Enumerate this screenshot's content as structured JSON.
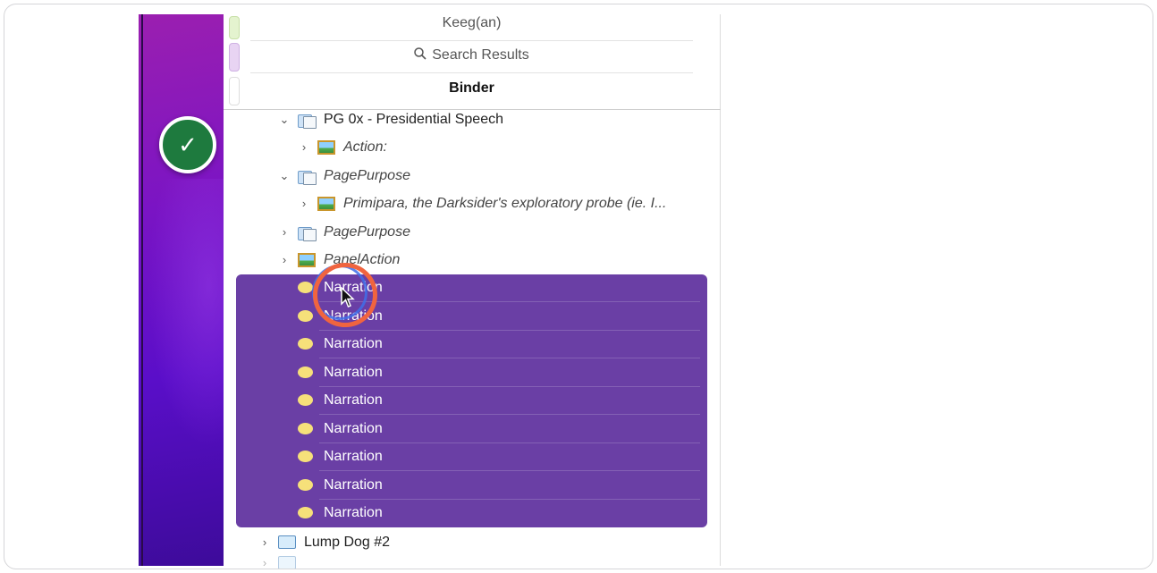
{
  "header": {
    "top_label": "Keeg(an)",
    "search_label": "Search Results",
    "binder_label": "Binder"
  },
  "tree": {
    "presidential": "PG 0x - Presidential Speech",
    "action": "Action:",
    "page_purpose_1": "PagePurpose",
    "primipara": "Primipara, the Darksider's exploratory probe (ie. I...",
    "page_purpose_2": "PagePurpose",
    "panel_action": "PanelAction",
    "narrations": [
      "Narration",
      "Narration",
      "Narration",
      "Narration",
      "Narration",
      "Narration",
      "Narration",
      "Narration",
      "Narration"
    ],
    "lump_dog": "Lump Dog #2"
  },
  "colors": {
    "selection": "#6a3fa5",
    "check_badge": "#1e7a3e",
    "highlight_ring": "#f0643f"
  }
}
